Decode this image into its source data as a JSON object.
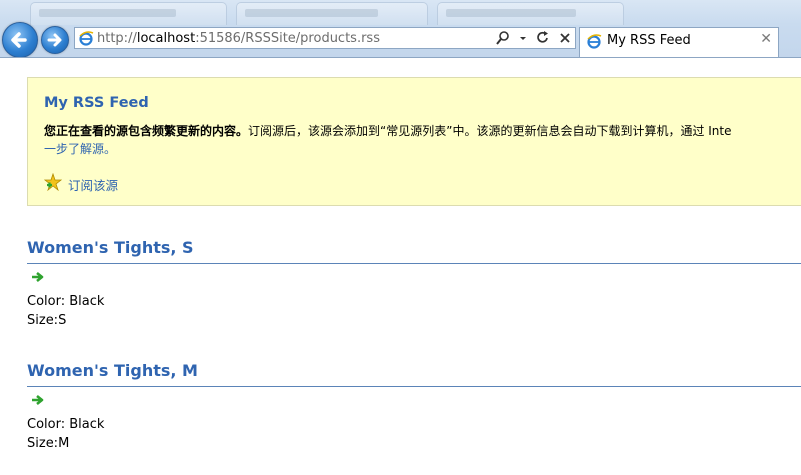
{
  "browser": {
    "url_prefix": "http://",
    "url_host": "localhost",
    "url_rest": ":51586/RSSSite/products.rss",
    "tab_title": "My RSS Feed",
    "tab_close": "✕"
  },
  "feed": {
    "title": "My RSS Feed",
    "desc_bold": "您正在查看的源包含频繁更新的内容。",
    "desc_text": "订阅源后，该源会添加到“常见源列表”中。该源的更新信息会自动下载到计算机，通过 Inte",
    "desc_more": "一步了解源。",
    "subscribe_label": "订阅该源"
  },
  "items": [
    {
      "title": "Women's Tights, S",
      "color": "Color: Black",
      "size": "Size:S"
    },
    {
      "title": "Women's Tights, M",
      "color": "Color: Black",
      "size": "Size:M"
    }
  ]
}
